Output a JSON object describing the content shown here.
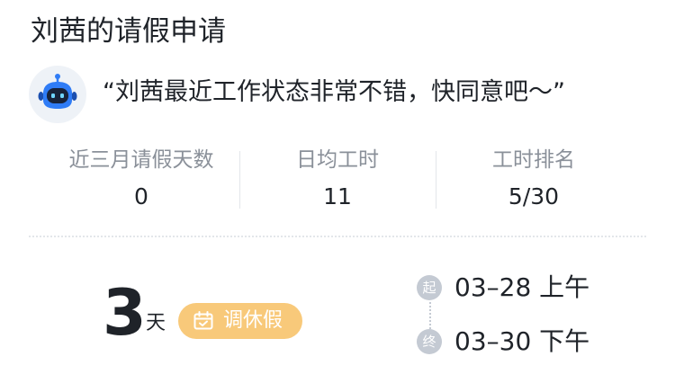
{
  "title": "刘茜的请假申请",
  "quote": "“刘茜最近工作状态非常不错，快同意吧～”",
  "stats": [
    {
      "label": "近三月请假天数",
      "value": "0"
    },
    {
      "label": "日均工时",
      "value": "11"
    },
    {
      "label": "工时排名",
      "value": "5/30"
    }
  ],
  "leave": {
    "days": "3",
    "unit": "天",
    "type": "调休假"
  },
  "period": {
    "start_tag": "起",
    "start": "03–28 上午",
    "end_tag": "终",
    "end": "03–30 下午"
  },
  "colors": {
    "badge": "#f8c97a",
    "timeline_dot": "#c4cad3",
    "muted_text": "#8a9099",
    "bot_blue": "#2f7cf6"
  },
  "icons": {
    "avatar": "robot-avatar-icon",
    "badge": "calendar-icon"
  }
}
